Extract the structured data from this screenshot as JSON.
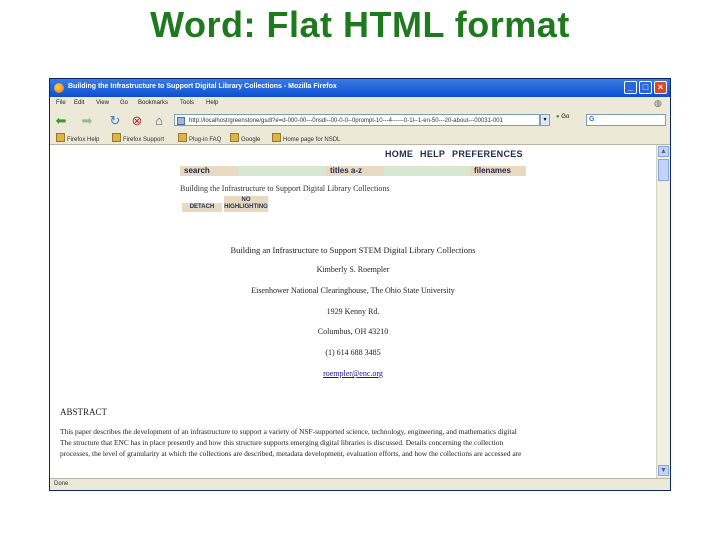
{
  "slide": {
    "title": "Word: Flat HTML format"
  },
  "browser": {
    "window_title": "Building the Infrastructure to Support Digital Library Collections - Mozilla Firefox",
    "window_buttons": {
      "minimize": "_",
      "maximize": "□",
      "close": "×"
    },
    "menu": [
      "File",
      "Edit",
      "View",
      "Go",
      "Bookmarks",
      "Tools",
      "Help"
    ],
    "nav_icons": [
      "back-icon",
      "forward-icon",
      "reload-icon",
      "stop-icon",
      "home-icon"
    ],
    "url": "http://localhost/greenstone/gsdl?e=d-000-00---0nsdl--00-0-0--0prompt-10---4------0-1l--1-en-50---20-about---00031-001",
    "go_label": "Go",
    "bookmarks": [
      "Firefox Help",
      "Firefox Support",
      "Plug-in FAQ",
      "Google",
      "Home page for NSDL"
    ],
    "status": "Done"
  },
  "page": {
    "top_links": [
      "HOME",
      "HELP",
      "PREFERENCES"
    ],
    "nav_tabs": [
      "search",
      "titles a-z",
      "filenames"
    ],
    "doc_heading": "Building the Infrastructure to Support Digital Library Collections",
    "buttons": {
      "detach": "DETACH",
      "no_highlighting": "NO HIGHLIGHTING"
    },
    "doc": {
      "title": "Building an Infrastructure to Support STEM Digital Library Collections",
      "author": "Kimberly S. Roempler",
      "affiliation": "Eisenhower National Clearinghouse, The Ohio State University",
      "address": "1929 Kenny Rd.",
      "city": "Columbus, OH 43210",
      "phone": "(1) 614 688 3485",
      "email": "roempler@enc.org"
    },
    "abstract_heading": "ABSTRACT",
    "abstract_lines": [
      "This paper describes the development of an infrastructure to support a variety of NSF-supported science, technology, engineering, and mathematics digital",
      "The structure that ENC has in place presently and how this structure supports emerging digital libraries is discussed. Details concerning the collection",
      "processes, the level of granularity at which the collections are described, metadata development, evaluation efforts, and how the collections are accessed are"
    ]
  }
}
